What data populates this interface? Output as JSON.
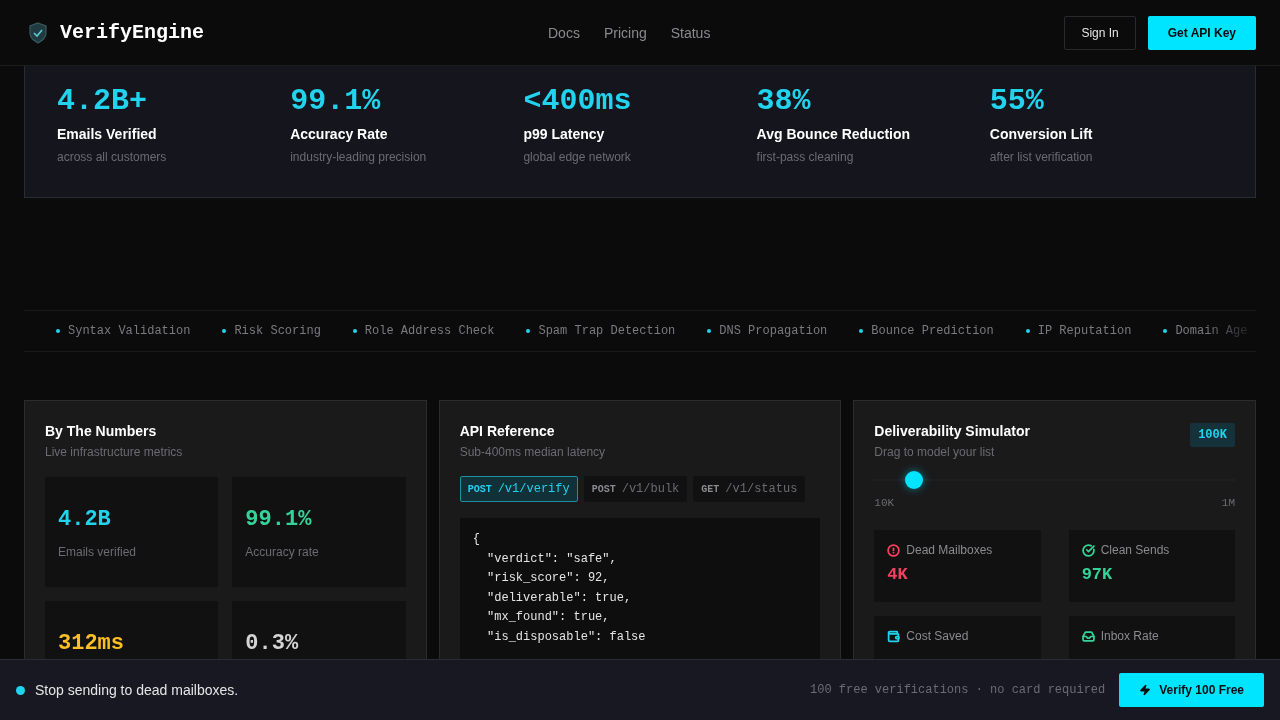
{
  "header": {
    "brand": "VerifyEngine",
    "nav": [
      {
        "label": "Docs"
      },
      {
        "label": "Pricing"
      },
      {
        "label": "Status"
      }
    ],
    "sign_in": "Sign In",
    "cta": "Get API Key"
  },
  "hero_stats": [
    {
      "value": "4.2B+",
      "label": "Emails Verified",
      "note": "across all customers"
    },
    {
      "value": "99.1%",
      "label": "Accuracy Rate",
      "note": "industry-leading precision"
    },
    {
      "value": "<400ms",
      "label": "p99 Latency",
      "note": "global edge network"
    },
    {
      "value": "38%",
      "label": "Avg Bounce Reduction",
      "note": "first-pass cleaning"
    },
    {
      "value": "55%",
      "label": "Conversion Lift",
      "note": "after list verification"
    }
  ],
  "ticker": [
    "Syntax Validation",
    "Risk Scoring",
    "Role Address Check",
    "Spam Trap Detection",
    "DNS Propagation",
    "Bounce Prediction",
    "IP Reputation",
    "Domain Age"
  ],
  "numbers_card": {
    "title": "By The Numbers",
    "subtitle": "Live infrastructure metrics",
    "metrics": [
      {
        "value": "4.2B",
        "label": "Emails verified",
        "color": "#22d3ee"
      },
      {
        "value": "99.1%",
        "label": "Accuracy rate",
        "color": "#34d399"
      },
      {
        "value": "312ms",
        "color": "#fbbf24"
      },
      {
        "value": "0.3%",
        "color": "#d4d4d4"
      }
    ]
  },
  "api_card": {
    "title": "API Reference",
    "subtitle": "Sub-400ms median latency",
    "endpoints": [
      {
        "method": "POST",
        "path": "/v1/verify",
        "selected": true
      },
      {
        "method": "POST",
        "path": "/v1/bulk",
        "selected": false
      },
      {
        "method": "GET",
        "path": "/v1/status",
        "selected": false
      }
    ],
    "code": [
      "{",
      "  \"verdict\": \"safe\",",
      "  \"risk_score\": 92,",
      "  \"deliverable\": true,",
      "  \"mx_found\": true,",
      "  \"is_disposable\": false"
    ]
  },
  "simulator_card": {
    "title": "Deliverability Simulator",
    "subtitle": "Drag to model your list",
    "badge": "100K",
    "slider": {
      "level": 0.11,
      "min": "10K",
      "max": "1M"
    },
    "results": [
      {
        "kind": "dead",
        "label": "Dead Mailboxes",
        "value": "4K",
        "color": "#f43f5e"
      },
      {
        "kind": "clean",
        "label": "Clean Sends",
        "value": "97K",
        "color": "#34d399"
      },
      {
        "kind": "cost",
        "label": "Cost Saved",
        "color": "#22d3ee"
      },
      {
        "kind": "inbox",
        "label": "Inbox Rate",
        "color": "#34d399"
      }
    ]
  },
  "bottom_bar": {
    "message": "Stop sending to dead mailboxes.",
    "note": "100 free verifications · no card required",
    "button": "Verify 100 Free"
  }
}
